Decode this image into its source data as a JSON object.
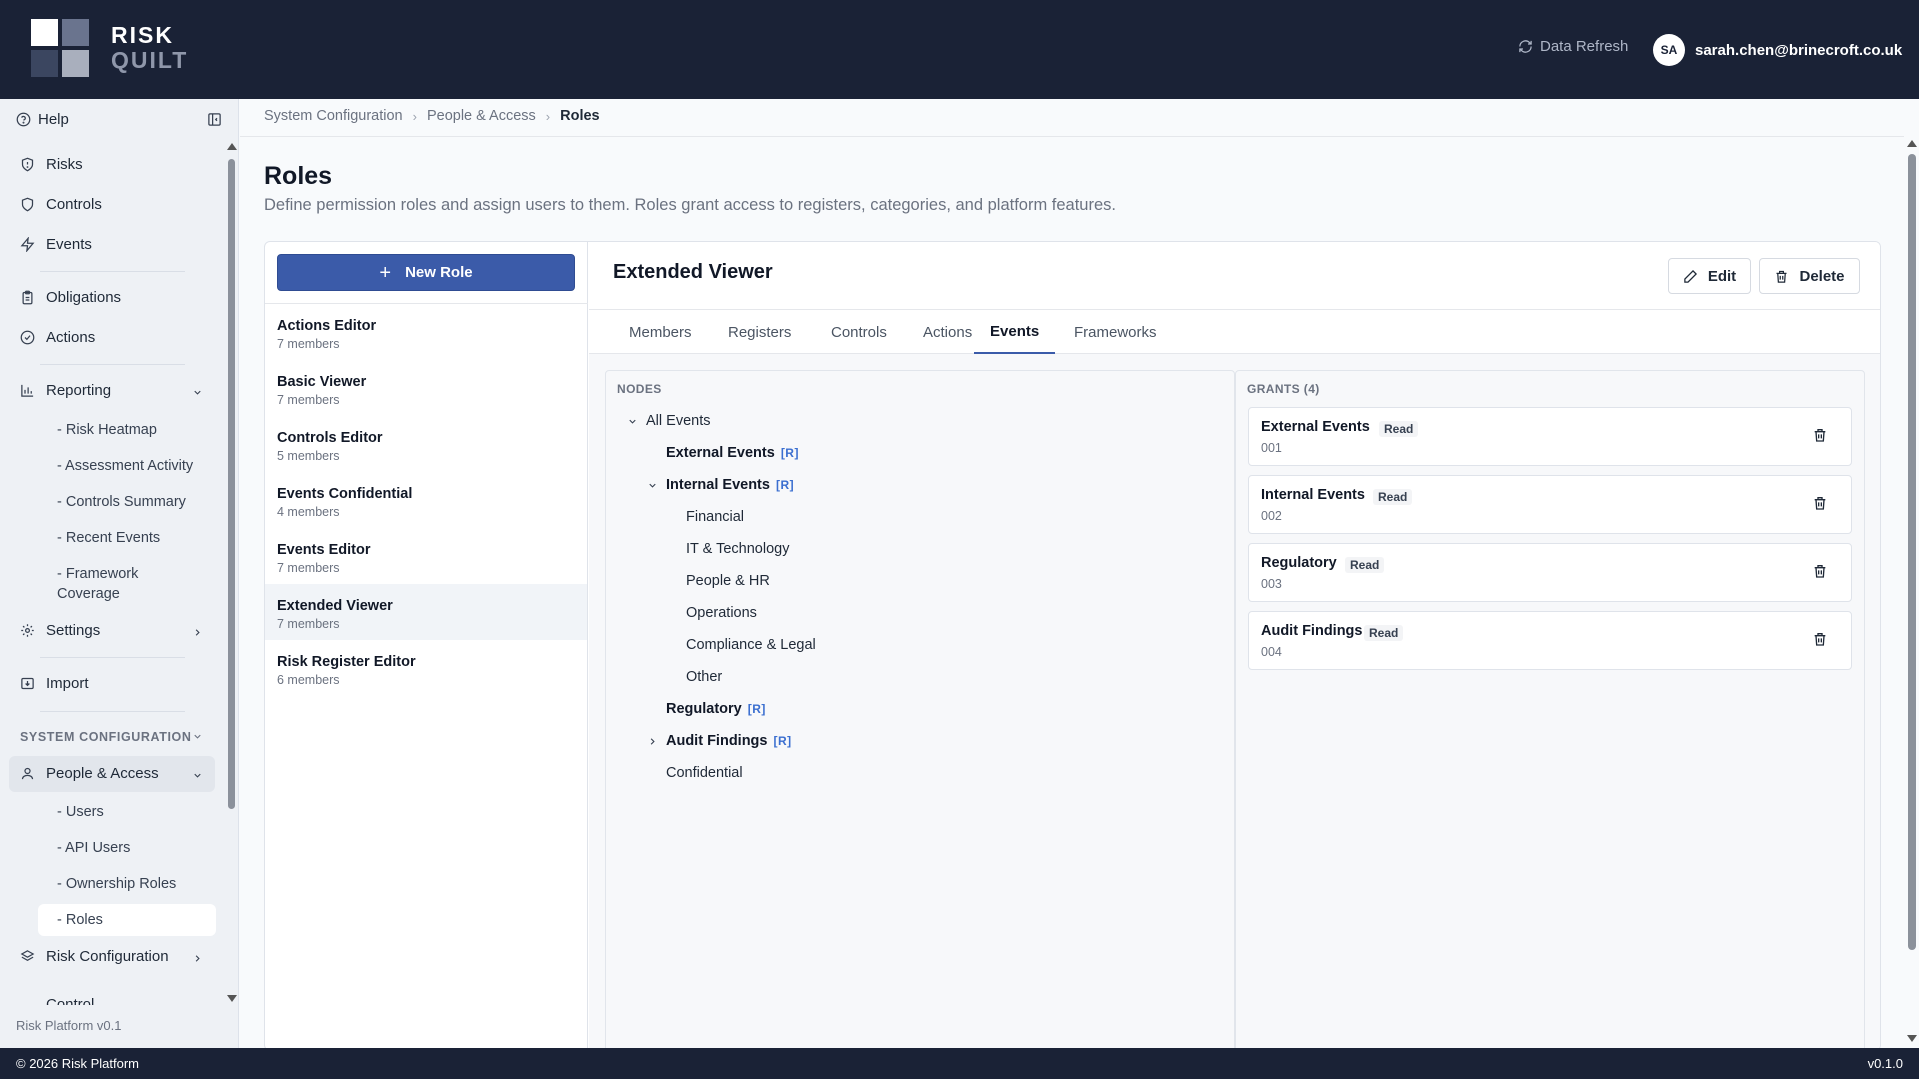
{
  "header": {
    "logo_line1": "RISK",
    "logo_line2": "QUILT",
    "refresh_label": "Data Refresh",
    "avatar_initials": "SA",
    "user_email": "sarah.chen@brinecroft.co.uk"
  },
  "sidebar": {
    "help_label": "Help",
    "items": {
      "risks": "Risks",
      "controls": "Controls",
      "events": "Events",
      "obligations": "Obligations",
      "actions": "Actions",
      "reporting": "Reporting",
      "settings": "Settings",
      "import": "Import",
      "people_access": "People & Access",
      "risk_configuration": "Risk Configuration",
      "control": "Control"
    },
    "reporting_subs": [
      "- Risk Heatmap",
      "- Assessment Activity",
      "- Controls Summary",
      "- Recent Events",
      "- Framework",
      "Coverage"
    ],
    "system_config_label": "SYSTEM CONFIGURATION",
    "people_subs": [
      "- Users",
      "- API Users",
      "- Ownership Roles",
      "- Roles"
    ],
    "version": "Risk Platform v0.1"
  },
  "footer": {
    "copyright": "© 2026 Risk Platform",
    "version": "v0.1.0"
  },
  "breadcrumb": [
    "System Configuration",
    "People & Access",
    "Roles"
  ],
  "page": {
    "title": "Roles",
    "description": "Define permission roles and assign users to them. Roles grant access to registers, categories, and platform features."
  },
  "roles": {
    "new_role_label": "New Role",
    "items": [
      {
        "name": "Actions Editor",
        "count": "7 members"
      },
      {
        "name": "Basic Viewer",
        "count": "7 members"
      },
      {
        "name": "Controls Editor",
        "count": "5 members"
      },
      {
        "name": "Events Confidential",
        "count": "4 members"
      },
      {
        "name": "Events Editor",
        "count": "7 members"
      },
      {
        "name": "Extended Viewer",
        "count": "7 members"
      },
      {
        "name": "Risk Register Editor",
        "count": "6 members"
      }
    ]
  },
  "detail": {
    "title": "Extended Viewer",
    "edit_label": "Edit",
    "delete_label": "Delete",
    "tabs": [
      "Members",
      "Registers",
      "Controls",
      "Actions",
      "Events",
      "Frameworks"
    ],
    "active_tab": "Events",
    "nodes_label": "NODES",
    "nodes": {
      "all_events": "All Events",
      "external_events": "External Events",
      "internal_events": "Internal Events",
      "financial": "Financial",
      "it_technology": "IT & Technology",
      "people_hr": "People & HR",
      "operations": "Operations",
      "compliance_legal": "Compliance & Legal",
      "other": "Other",
      "regulatory": "Regulatory",
      "audit_findings": "Audit Findings",
      "confidential": "Confidential",
      "read_tag": "[R]"
    },
    "grants_label": "GRANTS (4)",
    "grants": [
      {
        "name": "External Events",
        "level": "Read",
        "code": "001"
      },
      {
        "name": "Internal Events",
        "level": "Read",
        "code": "002"
      },
      {
        "name": "Regulatory",
        "level": "Read",
        "code": "003"
      },
      {
        "name": "Audit Findings",
        "level": "Read",
        "code": "004"
      }
    ]
  },
  "colors": {
    "header_bg": "#1a2236",
    "accent": "#3b5ba9",
    "tag_blue": "#3b6fd0"
  }
}
